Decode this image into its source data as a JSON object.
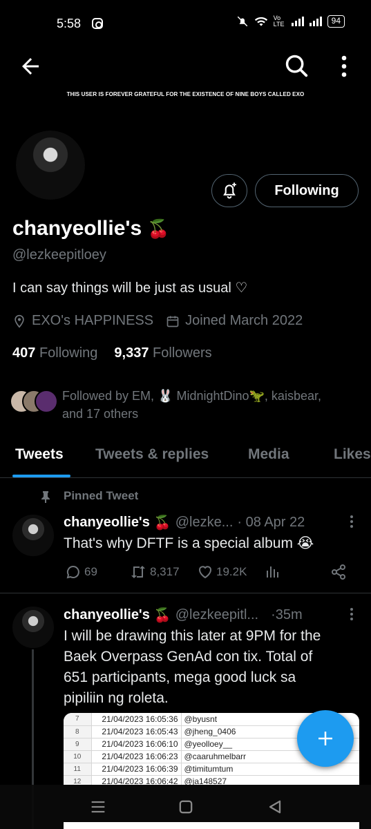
{
  "status_bar": {
    "time": "5:58",
    "network_label": "Vo LTE",
    "battery": "94"
  },
  "header": {
    "banner_text": "THIS USER IS FOREVER GRATEFUL FOR THE EXISTENCE OF NINE BOYS CALLED EXO"
  },
  "profile": {
    "display_name": "chanyeollie's",
    "name_emoji": "🍒",
    "handle": "@lezkeepitloey",
    "bio": "I can say things will be just as usual ♡",
    "location": "EXO's HAPPINESS",
    "joined": "Joined March 2022",
    "following_count": "407",
    "following_label": "Following",
    "followers_count": "9,337",
    "followers_label": "Followers",
    "following_button": "Following",
    "followed_by_line1": "Followed by EM, 🐰 MidnightDino🦖, kaisbear,",
    "followed_by_line2": "and 17 others"
  },
  "tabs": [
    "Tweets",
    "Tweets & replies",
    "Media",
    "Likes"
  ],
  "pinned_label": "Pinned Tweet",
  "tweets": [
    {
      "name": "chanyeollie's",
      "emoji": "🍒",
      "handle": "@lezke...",
      "time": "· 08 Apr 22",
      "text": "That's why DFTF is a special album 😭",
      "replies": "69",
      "retweets": "8,317",
      "likes": "19.2K"
    },
    {
      "name": "chanyeollie's",
      "emoji": "🍒",
      "handle": "@lezkeepitl...",
      "time": "·35m",
      "text_lines": [
        "I will be drawing this later at 9PM for the",
        "Baek Overpass GenAd con tix. Total of",
        "651 participants, mega good luck sa",
        "pipiliin ng roleta."
      ]
    }
  ],
  "attachment_rows": [
    {
      "num": "7",
      "date": "21/04/2023 16:05:36",
      "user": "@byusnt"
    },
    {
      "num": "8",
      "date": "21/04/2023 16:05:43",
      "user": "@jheng_0406"
    },
    {
      "num": "9",
      "date": "21/04/2023 16:06:10",
      "user": "@yeolloey__"
    },
    {
      "num": "10",
      "date": "21/04/2023 16:06:23",
      "user": "@caaruhmelbarr"
    },
    {
      "num": "11",
      "date": "21/04/2023 16:06:39",
      "user": "@timitumtum"
    },
    {
      "num": "12",
      "date": "21/04/2023 16:06:42",
      "user": "@ja148527"
    }
  ],
  "colors": {
    "accent": "#1d9bf0",
    "muted": "#71767b",
    "background": "#000000"
  }
}
